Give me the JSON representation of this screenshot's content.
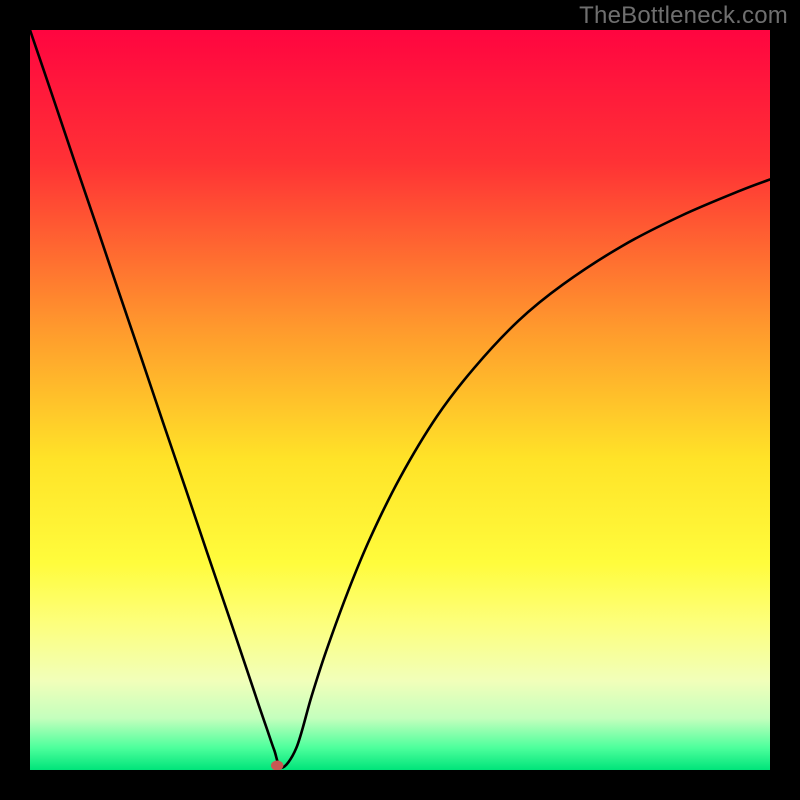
{
  "watermark": "TheBottleneck.com",
  "chart_data": {
    "type": "line",
    "title": "",
    "xlabel": "",
    "ylabel": "",
    "xlim": [
      0,
      100
    ],
    "ylim": [
      0,
      100
    ],
    "gradient_stops": [
      {
        "offset": 0,
        "color": "#ff0540"
      },
      {
        "offset": 18,
        "color": "#ff3235"
      },
      {
        "offset": 40,
        "color": "#ff982d"
      },
      {
        "offset": 58,
        "color": "#ffe328"
      },
      {
        "offset": 72,
        "color": "#fffc3c"
      },
      {
        "offset": 80,
        "color": "#fdff7b"
      },
      {
        "offset": 88,
        "color": "#f1ffba"
      },
      {
        "offset": 93,
        "color": "#c4ffbd"
      },
      {
        "offset": 97,
        "color": "#4dff9c"
      },
      {
        "offset": 100,
        "color": "#00e47a"
      }
    ],
    "series": [
      {
        "name": "bottleneck-curve",
        "x": [
          0,
          3,
          6,
          9,
          12,
          15,
          18,
          21,
          24,
          27,
          30,
          31,
          32,
          33,
          34,
          36,
          38,
          40,
          43,
          46,
          50,
          55,
          60,
          66,
          72,
          80,
          88,
          96,
          100
        ],
        "y": [
          100,
          91.2,
          82.3,
          73.5,
          64.6,
          55.8,
          46.9,
          38.1,
          29.2,
          20.4,
          11.5,
          8.5,
          5.6,
          2.7,
          0.3,
          3.0,
          9.8,
          16.0,
          24.2,
          31.4,
          39.5,
          47.8,
          54.3,
          60.7,
          65.6,
          70.8,
          74.9,
          78.3,
          79.8
        ]
      }
    ],
    "marker": {
      "x": 33.4,
      "y": 0.6,
      "color": "#c75a53"
    }
  }
}
